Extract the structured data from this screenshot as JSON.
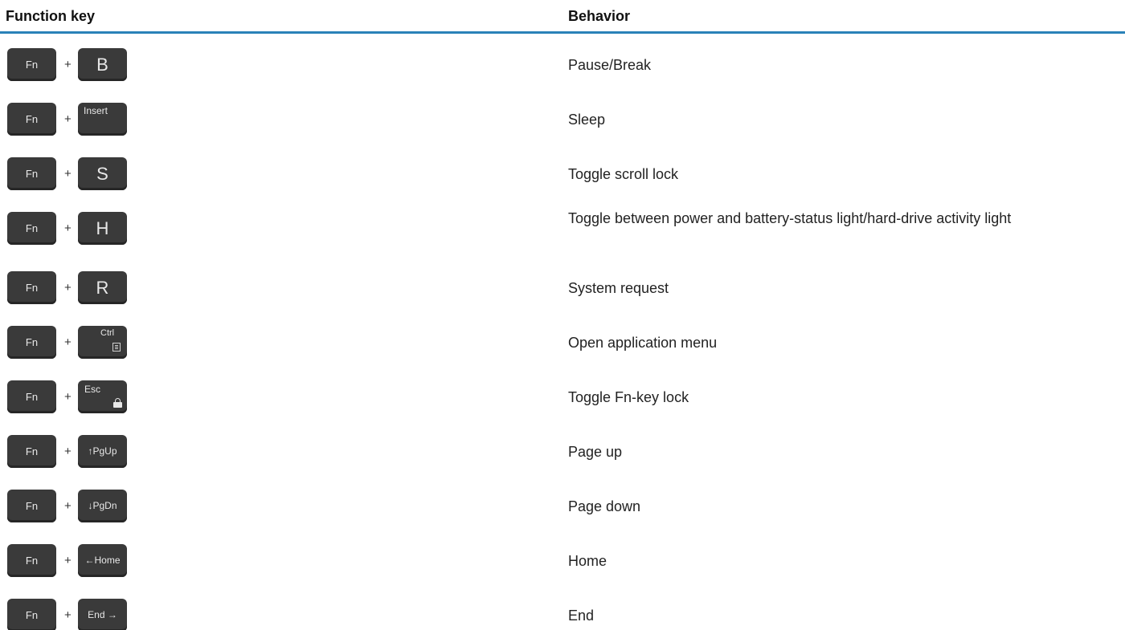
{
  "header": {
    "col_function_key": "Function key",
    "col_behavior": "Behavior"
  },
  "accent_color": "#2a82b8",
  "key_color": "#3a3a3a",
  "rows": [
    {
      "fn": "Fn",
      "plus": "+",
      "key": "B",
      "behavior": "Pause/Break"
    },
    {
      "fn": "Fn",
      "plus": "+",
      "key": "Insert",
      "behavior": "Sleep"
    },
    {
      "fn": "Fn",
      "plus": "+",
      "key": "S",
      "behavior": "Toggle scroll lock"
    },
    {
      "fn": "Fn",
      "plus": "+",
      "key": "H",
      "behavior": "Toggle between power and battery-status light/hard-drive activity light"
    },
    {
      "fn": "Fn",
      "plus": "+",
      "key": "R",
      "behavior": "System request"
    },
    {
      "fn": "Fn",
      "plus": "+",
      "key": "Ctrl",
      "icon": "menu-icon",
      "behavior": "Open application menu"
    },
    {
      "fn": "Fn",
      "plus": "+",
      "key": "Esc",
      "icon": "lock-icon",
      "behavior": "Toggle Fn-key lock"
    },
    {
      "fn": "Fn",
      "plus": "+",
      "key": "↑PgUp",
      "behavior": "Page up"
    },
    {
      "fn": "Fn",
      "plus": "+",
      "key": "↓PgDn",
      "behavior": "Page down"
    },
    {
      "fn": "Fn",
      "plus": "+",
      "key": "←Home",
      "behavior": "Home"
    },
    {
      "fn": "Fn",
      "plus": "+",
      "key": "End →",
      "behavior": "End"
    }
  ]
}
